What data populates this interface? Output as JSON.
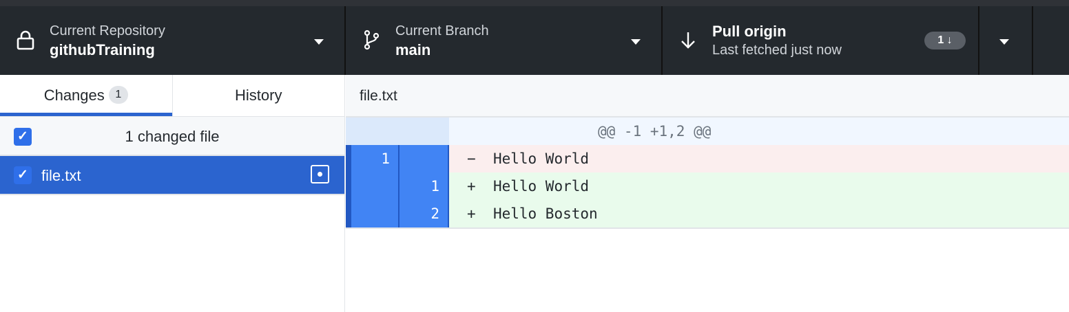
{
  "toolbar": {
    "repo": {
      "label": "Current Repository",
      "value": "githubTraining"
    },
    "branch": {
      "label": "Current Branch",
      "value": "main"
    },
    "pull": {
      "title": "Pull origin",
      "subtitle": "Last fetched just now",
      "badge": "1 ↓"
    }
  },
  "sidebar": {
    "tabs": [
      {
        "label": "Changes",
        "count": "1"
      },
      {
        "label": "History"
      }
    ],
    "changed_summary": "1 changed file",
    "files": [
      {
        "name": "file.txt",
        "status": "modified"
      }
    ]
  },
  "diff": {
    "file": "file.txt",
    "hunk": "@@ -1 +1,2 @@",
    "lines": [
      {
        "old": "1",
        "new": "",
        "sign": "−",
        "text": "Hello World"
      },
      {
        "old": "",
        "new": "1",
        "sign": "+",
        "text": "Hello World"
      },
      {
        "old": "",
        "new": "2",
        "sign": "+",
        "text": "Hello Boston"
      }
    ]
  },
  "colors": {
    "accent": "#2b64cf",
    "toolbar": "#24292e",
    "selected_gutter": "#4184f4"
  }
}
